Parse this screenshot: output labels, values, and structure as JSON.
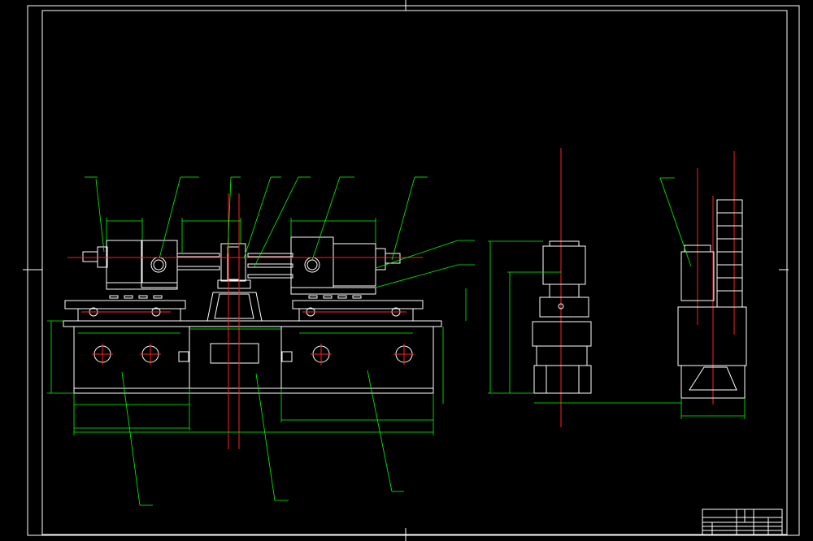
{
  "drawing": {
    "title_block": {
      "name": "",
      "cells": [
        "",
        "",
        "",
        ""
      ]
    },
    "callouts": [
      "",
      "",
      "",
      "",
      "",
      "",
      "",
      "",
      "",
      "",
      "",
      "",
      ""
    ],
    "dimensions": [
      "",
      "",
      "",
      "",
      "",
      "",
      "",
      "",
      "",
      "",
      "",
      "",
      "",
      "",
      "",
      "",
      ""
    ],
    "colors": {
      "background": "#000000",
      "geometry": "#ffffff",
      "centerline": "#ff2020",
      "annotation": "#00ff00"
    }
  }
}
